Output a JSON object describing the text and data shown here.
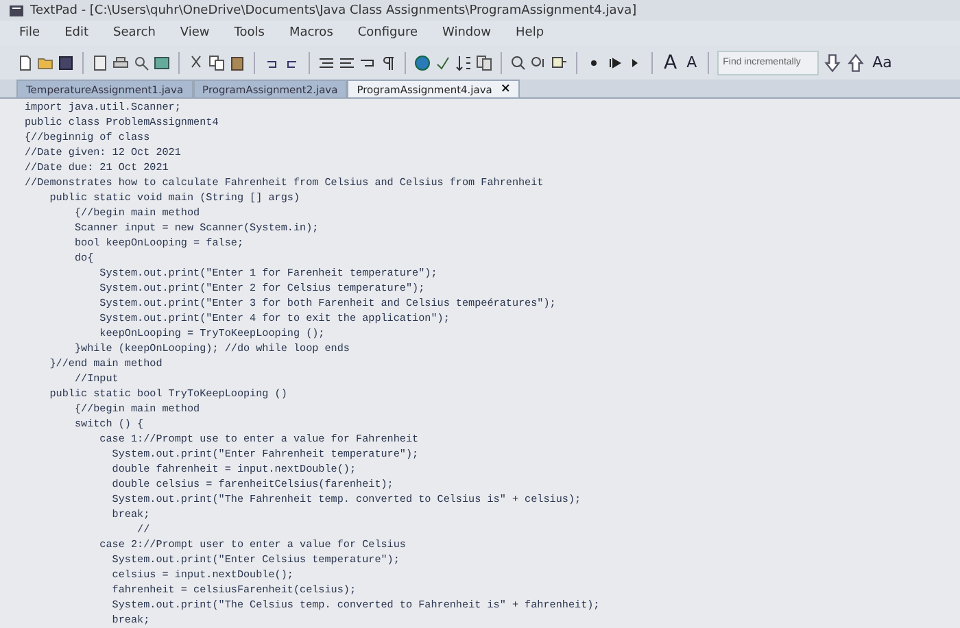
{
  "window": {
    "title": "TextPad - [C:\\Users\\quhr\\OneDrive\\Documents\\Java Class Assignments\\ProgramAssignment4.java]"
  },
  "menu": [
    "File",
    "Edit",
    "Search",
    "View",
    "Tools",
    "Macros",
    "Configure",
    "Window",
    "Help"
  ],
  "toolbar": {
    "font_larger": "A",
    "font_smaller": "A",
    "search": {
      "placeholder": "Find incrementally"
    },
    "match_case": "Aa"
  },
  "tabs": [
    {
      "label": "TemperatureAssignment1.java",
      "selected": false
    },
    {
      "label": "ProgramAssignment2.java",
      "selected": false
    },
    {
      "label": "ProgramAssignment4.java",
      "selected": true,
      "close": "×"
    }
  ],
  "code_lines": [
    "import java.util.Scanner;",
    "public class ProblemAssignment4",
    "{//beginnig of class",
    "//Date given: 12 Oct 2021",
    "//Date due: 21 Oct 2021",
    "//Demonstrates how to calculate Fahrenheit from Celsius and Celsius from Fahrenheit",
    "    public static void main (String [] args)",
    "        {//begin main method",
    "        Scanner input = new Scanner(System.in);",
    "        bool keepOnLooping = false;",
    "        do{",
    "            System.out.print(\"Enter 1 for Farenheit temperature\");",
    "            System.out.print(\"Enter 2 for Celsius temperature\");",
    "            System.out.print(\"Enter 3 for both Farenheit and Celsius tempeératures\");",
    "            System.out.print(\"Enter 4 for to exit the application\");",
    "            keepOnLooping = TryToKeepLooping ();",
    "        }while (keepOnLooping); //do while loop ends",
    "    }//end main method",
    "        //Input",
    "    public static bool TryToKeepLooping ()",
    "        {//begin main method",
    "        switch () {",
    "            case 1://Prompt use to enter a value for Fahrenheit",
    "              System.out.print(\"Enter Fahrenheit temperature\");",
    "              double fahrenheit = input.nextDouble();",
    "              double celsius = farenheitCelsius(farenheit);",
    "              System.out.print(\"The Fahrenheit temp. converted to Celsius is\" + celsius);",
    "              break;",
    "                  //",
    "            case 2://Prompt user to enter a value for Celsius",
    "              System.out.print(\"Enter Celsius temperature\");",
    "              celsius = input.nextDouble();",
    "              fahrenheit = celsiusFarenheit(celsius);",
    "              System.out.print(\"The Celsius temp. converted to Fahrenheit is\" + fahrenheit);",
    "              break;"
  ]
}
